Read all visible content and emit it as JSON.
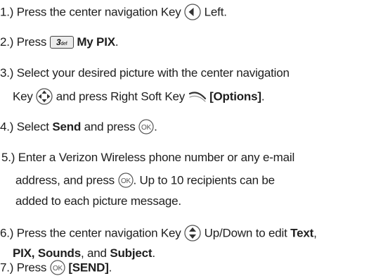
{
  "steps": [
    {
      "num": "1.)",
      "a": "Press the center navigation Key",
      "b": "Left."
    },
    {
      "num": "2.)",
      "a": "Press",
      "key_num": "3",
      "key_sub": "def",
      "b": "My PIX",
      "c": "."
    },
    {
      "num": "3.)",
      "a": "Select your desired picture with the center navigation",
      "b": "Key",
      "c": "and press Right Soft Key",
      "d": "[Options]",
      "e": "."
    },
    {
      "num": "4.)",
      "a": "Select",
      "b": "Send",
      "c": "and press",
      "d": "."
    },
    {
      "num": "5.)",
      "a": "Enter a Verizon Wireless phone number or any e-mail",
      "b": "address, and press",
      "c": ". Up to 10 recipients can be",
      "d": "added to each picture message."
    },
    {
      "num": "6.)",
      "a": "Press the center navigation Key",
      "b": "Up/Down to edit",
      "c": "Text",
      "d": ",",
      "e": "PIX,",
      "f": "Sounds",
      "g": ", and",
      "h": "Subject",
      "i": "."
    },
    {
      "num": "7.)",
      "a": "Press",
      "b": "[SEND]",
      "c": "."
    }
  ],
  "icons": {
    "nav_left": "nav-left-icon",
    "key_3": "key-3-def-icon",
    "nav_all": "nav-four-way-icon",
    "soft_right": "right-soft-key-icon",
    "ok": "ok-key-icon",
    "nav_updown": "nav-up-down-icon"
  }
}
